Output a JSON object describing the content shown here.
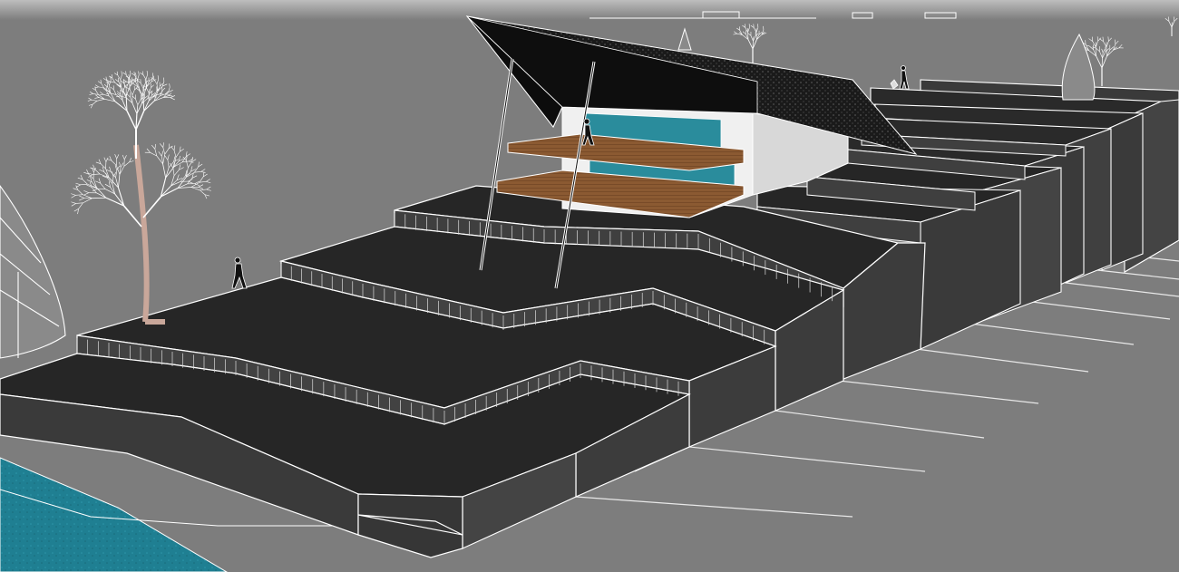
{
  "scene": {
    "kind": "3d-architectural-render",
    "subject": "terraced-landscape-with-cantilevered-house",
    "colors": {
      "ground": "#7d7d7d",
      "sky_band": "#9a9a9a",
      "terrace_top": "#2a2a2a",
      "terrace_side": "#3c3c3c",
      "edge": "#ffffff",
      "water": "#1f7f92",
      "roof": "#111111",
      "deck": "#8b5a32",
      "glass": "#2a8c9c",
      "wall": "#f0f0f0",
      "tree_trunk": "#c9a79a"
    }
  }
}
